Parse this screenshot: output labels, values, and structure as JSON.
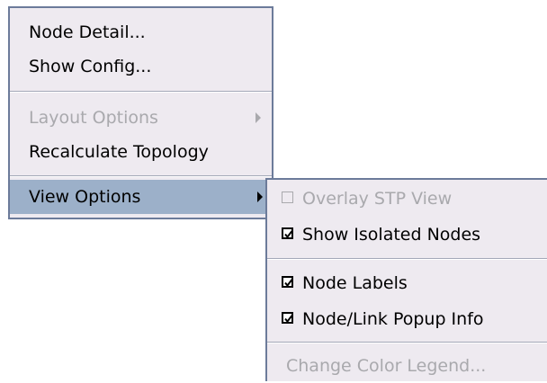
{
  "context_menu": {
    "items": [
      {
        "label": "Node Detail...",
        "enabled": true
      },
      {
        "label": "Show Config...",
        "enabled": true
      },
      {
        "label": "Layout Options",
        "enabled": false,
        "has_submenu": true
      },
      {
        "label": "Recalculate Topology",
        "enabled": true
      },
      {
        "label": "View Options",
        "enabled": true,
        "has_submenu": true,
        "selected": true
      }
    ]
  },
  "view_options_submenu": {
    "items": [
      {
        "label": "Overlay STP View",
        "enabled": false,
        "checked": false
      },
      {
        "label": "Show Isolated Nodes",
        "enabled": true,
        "checked": true
      },
      {
        "label": "Node Labels",
        "enabled": true,
        "checked": true
      },
      {
        "label": "Node/Link Popup Info",
        "enabled": true,
        "checked": true
      },
      {
        "label": "Change Color Legend...",
        "enabled": false
      }
    ]
  },
  "colors": {
    "menu_background": "#eeeaf0",
    "menu_border": "#6c7b9a",
    "selection_background": "#9cb0c9",
    "disabled_text": "#a9a9ad"
  }
}
